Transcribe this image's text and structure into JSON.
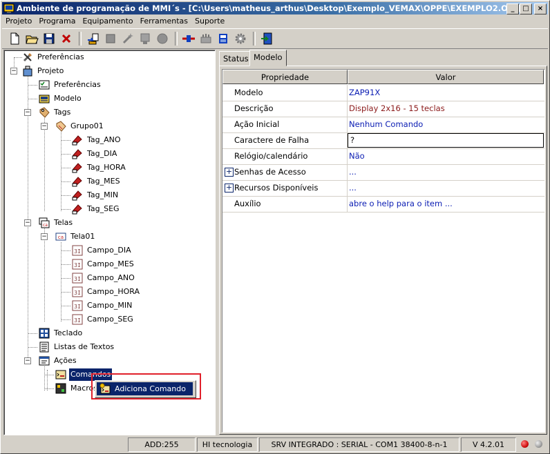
{
  "window": {
    "title": "Ambiente de programação de MMI´s - [C:\\Users\\matheus_arthus\\Desktop\\Exemplo_VEMAX\\OPPE\\EXEMPLO2.OPJ]",
    "min_label": "_",
    "max_label": "□",
    "close_label": "×"
  },
  "menu": [
    "Projeto",
    "Programa",
    "Equipamento",
    "Ferramentas",
    "Suporte"
  ],
  "toolbar_icons": [
    "new-file-icon",
    "open-folder-icon",
    "save-icon",
    "delete-icon",
    "import-icon",
    "chip-icon",
    "wand-icon",
    "module-icon",
    "record-icon",
    "transfer-icon",
    "network-icon",
    "emulator-icon",
    "gear-icon",
    "exit-icon"
  ],
  "tree": {
    "preferencias_root": "Preferências",
    "projeto": "Projeto",
    "preferencias": "Preferências",
    "modelo": "Modelo",
    "tags": "Tags",
    "grupo01": "Grupo01",
    "tag_items": [
      "Tag_ANO",
      "Tag_DIA",
      "Tag_HORA",
      "Tag_MES",
      "Tag_MIN",
      "Tag_SEG"
    ],
    "telas": "Telas",
    "tela01": "Tela01",
    "campo_items": [
      "Campo_DIA",
      "Campo_MES",
      "Campo_ANO",
      "Campo_HORA",
      "Campo_MIN",
      "Campo_SEG"
    ],
    "teclado": "Teclado",
    "listas": "Listas de Textos",
    "acoes": "Ações",
    "comandos": "Comandos",
    "macros": "Macros",
    "icon_labels": {
      "tela": "ca",
      "campo": "3I"
    }
  },
  "tabs": [
    "Status",
    "Modelo"
  ],
  "grid": {
    "header": {
      "prop": "Propriedade",
      "val": "Valor"
    },
    "rows": [
      {
        "prop": "Modelo",
        "val": "ZAP91X"
      },
      {
        "prop": "Descrição",
        "val": "Display 2x16 - 15 teclas"
      },
      {
        "prop": "Ação Inicial",
        "val": "Nenhum Comando"
      },
      {
        "prop": "Caractere de Falha",
        "val": "?"
      },
      {
        "prop": "Relógio/calendário",
        "val": "Não"
      },
      {
        "prop": "Senhas de Acesso",
        "val": "..."
      },
      {
        "prop": "Recursos Disponíveis",
        "val": "..."
      },
      {
        "prop": "Auxílio",
        "val": "abre o help para o item ..."
      }
    ],
    "expander_label": "+"
  },
  "context_menu": {
    "item": "Adiciona Comando"
  },
  "status": {
    "add": "ADD:255",
    "company": "HI tecnologia",
    "connection": "SRV INTEGRADO : SERIAL - COM1 38400-8-n-1",
    "version": "V 4.2.01"
  },
  "colors": {
    "title_start": "#0a246a",
    "selection": "#0a246a",
    "value_blue": "#0a1cb3",
    "value_red": "#8b1a1a",
    "highlight_box": "#e0202a",
    "led_red": "#d01010",
    "led_gray": "#a0a0a0"
  }
}
